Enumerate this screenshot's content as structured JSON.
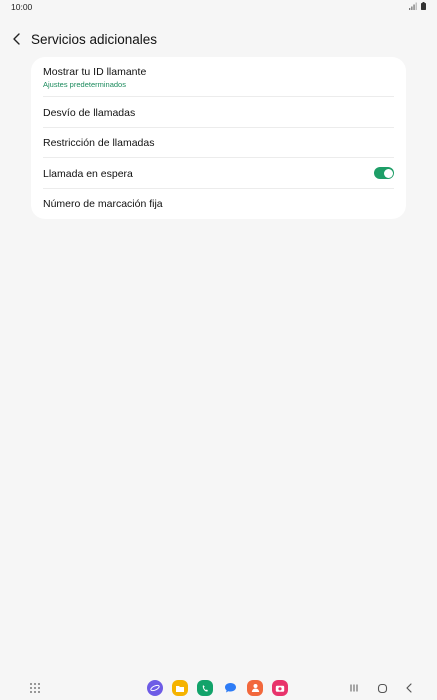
{
  "status_bar": {
    "time": "10:00"
  },
  "header": {
    "title": "Servicios adicionales",
    "back_icon": "chevron-left-icon"
  },
  "settings": {
    "items": [
      {
        "label": "Mostrar tu ID llamante",
        "sublabel": "Ajustes predeterminados"
      },
      {
        "label": "Desvío de llamadas"
      },
      {
        "label": "Restricción de llamadas"
      },
      {
        "label": "Llamada en espera",
        "toggle_on": true
      },
      {
        "label": "Número de marcación fija"
      }
    ]
  },
  "colors": {
    "accent": "#1e9e67",
    "sublabel": "#1a8a5c",
    "background": "#f6f6f6",
    "card": "#ffffff"
  },
  "nav_bar": {
    "apps": [
      {
        "name": "internet-app-icon",
        "color": "#6e5ce6"
      },
      {
        "name": "files-app-icon",
        "color": "#f5b300"
      },
      {
        "name": "phone-app-icon",
        "color": "#12a36a"
      },
      {
        "name": "messages-app-icon",
        "color": "#2e7cf6"
      },
      {
        "name": "contacts-app-icon",
        "color": "#f2683c"
      },
      {
        "name": "camera-app-icon",
        "color": "#e8336b"
      }
    ],
    "buttons": [
      "recents-icon",
      "home-icon",
      "back-icon"
    ]
  }
}
